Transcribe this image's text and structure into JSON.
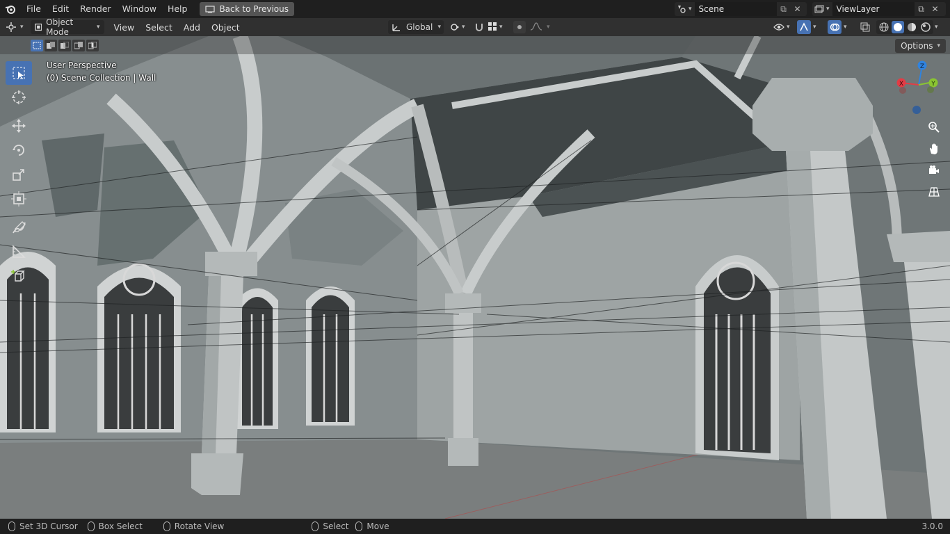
{
  "menubar": {
    "items": [
      "File",
      "Edit",
      "Render",
      "Window",
      "Help"
    ],
    "back_button": "Back to Previous",
    "scene_name": "Scene",
    "view_layer": "ViewLayer"
  },
  "header": {
    "mode": "Object Mode",
    "menus": [
      "View",
      "Select",
      "Add",
      "Object"
    ],
    "orientation": "Global"
  },
  "viewport": {
    "perspective": "User Perspective",
    "collection_info": "(0) Scene Collection | Wall",
    "options_label": "Options",
    "gizmo_axes": {
      "x": "X",
      "y": "Y",
      "z": "Z"
    }
  },
  "toolbar": {
    "tools": [
      "select-box",
      "cursor",
      "move",
      "rotate",
      "scale",
      "transform",
      "annotate",
      "measure",
      "add-cube"
    ]
  },
  "statusbar": {
    "items": [
      "Set 3D Cursor",
      "Box Select",
      "Rotate View",
      "Select",
      "Move"
    ],
    "version": "3.0.0"
  },
  "colors": {
    "accent": "#4772b3",
    "axis_x": "#e33c45",
    "axis_y": "#8ac532",
    "axis_z": "#2f83e0"
  }
}
